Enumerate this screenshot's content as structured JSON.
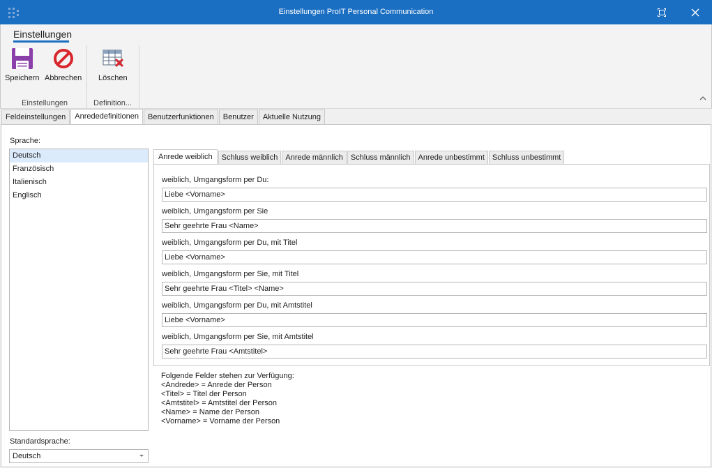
{
  "window": {
    "title": "Einstellungen ProIT Personal Communication"
  },
  "ribbon": {
    "tab_label": "Einstellungen",
    "buttons": {
      "save": "Speichern",
      "cancel": "Abbrechen",
      "delete": "Löschen"
    },
    "groups": {
      "settings": "Einstellungen",
      "definition": "Definition..."
    }
  },
  "tabs": [
    "Feldeinstellungen",
    "Anrededefinitionen",
    "Benutzerfunktionen",
    "Benutzer",
    "Aktuelle Nutzung"
  ],
  "language": {
    "label": "Sprache:",
    "items": [
      "Deutsch",
      "Französisch",
      "Italienisch",
      "Englisch"
    ],
    "default_label": "Standardsprache:",
    "default_value": "Deutsch"
  },
  "subtabs": [
    "Anrede weiblich",
    "Schluss weiblich",
    "Anrede männlich",
    "Schluss männlich",
    "Anrede unbestimmt",
    "Schluss unbestimmt"
  ],
  "fields": [
    {
      "label": "weiblich, Umgangsform per Du:",
      "value": "Liebe <Vorname>"
    },
    {
      "label": "weiblich, Umgangsform per Sie",
      "value": "Sehr geehrte Frau <Name>"
    },
    {
      "label": "weiblich, Umgangsform per Du, mit Titel",
      "value": "Liebe <Vorname>"
    },
    {
      "label": "weiblich, Umgangsform per Sie, mit Titel",
      "value": "Sehr geehrte Frau <Titel> <Name>"
    },
    {
      "label": "weiblich, Umgangsform per Du, mit Amtstitel",
      "value": "Liebe <Vorname>"
    },
    {
      "label": "weiblich, Umgangsform per Sie, mit Amtstitel",
      "value": "Sehr geehrte Frau <Amtstitel>"
    }
  ],
  "info_lines": [
    "Folgende Felder stehen zur Verfügung:",
    "<Andrede> = Anrede der Person",
    "<Titel> = Titel der Person",
    "<Amtstitel> = Amtstitel der Person",
    "<Name> = Name der Person",
    "<Vorname> = Vorname der Person"
  ],
  "colors": {
    "titlebar": "#1b6fc2",
    "selection": "#dcebfc",
    "save_icon": "#8b3fa8",
    "cancel_icon": "#d9262c"
  }
}
